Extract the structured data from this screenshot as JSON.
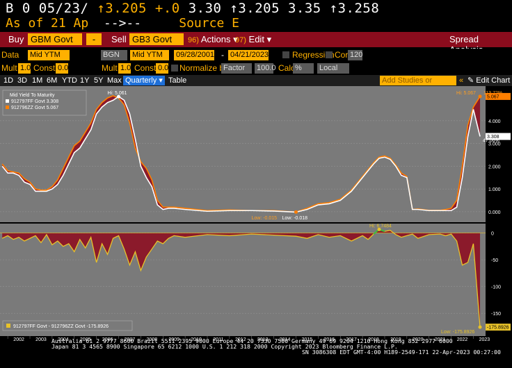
{
  "ticker": {
    "line1_a": "B 0 05/23/ ",
    "line1_b": "↑3.205",
    "line1_c": " +.0 ",
    "line1_d": "3.30 ",
    "line1_e": "↑3.205 3.35 ↑3.258",
    "line2_a": "As of 21 Ap  ",
    "line2_b": "-->--",
    "line2_c": "     Source E"
  },
  "toolbar": {
    "buy_label": "Buy",
    "buy_value": "GBM Govt",
    "minus_label": "-",
    "sell_label": "Sell",
    "sell_value": "GB3 Govt",
    "actions_num": "96)",
    "actions_label": "Actions",
    "edit_num": "97)",
    "edit_label": "Edit",
    "title": "Spread Analysis"
  },
  "params": {
    "data_label": "Data",
    "data_value": "Mid YTM",
    "bgn_value": "BGN",
    "field2_value": "Mid YTM",
    "start_date": "09/28/2001",
    "end_date": "04/21/2023",
    "regression_label": "Regression",
    "corr_label": "Corr",
    "corr_value": "120",
    "mult_label": "Mult",
    "mult_value": "1.0",
    "const_label": "Const",
    "const_value": "0.0",
    "mult2_label": "Mult",
    "mult2_value": "1.0",
    "const2_label": "Const",
    "const2_value": "0.0",
    "normalize_label": "Normalize by",
    "factor_value": "Factor",
    "factor_num": "100.0",
    "calc_label": "Calc",
    "calc_value": "%",
    "ccy_value": "Local CCY"
  },
  "range": {
    "items": [
      "1D",
      "3D",
      "1M",
      "6M",
      "YTD",
      "1Y",
      "5Y",
      "Max"
    ],
    "active": "Quarterly",
    "table": "Table",
    "add_studies": "Add Studies or Events",
    "edit_chart": "Edit Chart"
  },
  "chart_data": [
    {
      "type": "line",
      "title": "Mid Yield To Maturity",
      "x": [
        2001.75,
        2002.0,
        2002.25,
        2002.5,
        2002.75,
        2003.0,
        2003.25,
        2003.5,
        2003.75,
        2004.0,
        2004.25,
        2004.5,
        2004.75,
        2005.0,
        2005.25,
        2005.5,
        2005.75,
        2006.0,
        2006.25,
        2006.5,
        2006.75,
        2007.0,
        2007.25,
        2007.5,
        2007.75,
        2008.0,
        2008.25,
        2008.5,
        2008.75,
        2009.0,
        2009.25,
        2009.5,
        2010.0,
        2011.0,
        2012.0,
        2013.0,
        2014.0,
        2015.0,
        2015.5,
        2016.0,
        2016.5,
        2017.0,
        2017.5,
        2018.0,
        2018.25,
        2018.5,
        2018.75,
        2019.0,
        2019.25,
        2019.5,
        2019.75,
        2020.0,
        2020.25,
        2020.5,
        2021.0,
        2021.5,
        2021.75,
        2022.0,
        2022.25,
        2022.5,
        2022.75,
        2023.0,
        2023.3
      ],
      "series": [
        {
          "name": "912797FF Govt",
          "last": "3.308",
          "color": "#ffffff",
          "values": [
            2.0,
            1.7,
            1.7,
            1.6,
            1.3,
            1.2,
            0.9,
            0.9,
            0.9,
            1.0,
            1.2,
            1.6,
            2.1,
            2.6,
            2.8,
            3.2,
            3.6,
            4.3,
            4.6,
            4.8,
            4.9,
            5.06,
            4.9,
            4.3,
            3.2,
            2.0,
            1.5,
            1.1,
            0.3,
            0.1,
            0.15,
            0.15,
            0.1,
            0.02,
            0.05,
            0.05,
            0.03,
            -0.018,
            0.1,
            0.3,
            0.35,
            0.5,
            0.9,
            1.5,
            1.8,
            2.1,
            2.35,
            2.4,
            2.3,
            2.0,
            1.6,
            1.5,
            0.1,
            0.1,
            0.05,
            0.05,
            0.05,
            0.05,
            0.2,
            1.5,
            3.3,
            4.5,
            3.308
          ]
        },
        {
          "name": "912796ZZ Govt",
          "last": "5.067",
          "color": "#ff7f00",
          "values": [
            2.1,
            1.8,
            1.75,
            1.7,
            1.45,
            1.3,
            1.0,
            0.95,
            0.95,
            1.1,
            1.4,
            1.9,
            2.4,
            2.9,
            3.1,
            3.5,
            3.9,
            4.5,
            4.8,
            5.0,
            5.1,
            5.0,
            4.7,
            3.9,
            2.8,
            2.2,
            1.9,
            1.4,
            0.5,
            0.2,
            0.2,
            0.2,
            0.15,
            0.05,
            0.08,
            0.05,
            0.05,
            -0.015,
            0.15,
            0.35,
            0.4,
            0.55,
            0.95,
            1.55,
            1.85,
            2.15,
            2.4,
            2.45,
            2.35,
            2.05,
            1.7,
            1.55,
            0.1,
            0.12,
            0.06,
            0.06,
            0.1,
            0.15,
            0.5,
            2.0,
            3.8,
            4.6,
            5.067
          ]
        }
      ],
      "hi_white": "Hi: 5.061",
      "hi_orange": "Hi: 5.067",
      "hi_pct": "113.72%",
      "low_orange": "Low: -0.015",
      "low_white": "Low: -0.018",
      "last_pct": "47.06%",
      "yticks": [
        "0.000",
        "1.000",
        "2.000",
        "3.000",
        "4.000"
      ],
      "ylim": [
        -0.4,
        5.4
      ]
    },
    {
      "type": "area",
      "title": "912797FF Govt - 912796ZZ Govt",
      "last": "-175.8926",
      "hi": "Hi: 6.7484",
      "low": "Low: -175.8926",
      "x": [
        2001.75,
        2002.0,
        2002.25,
        2002.5,
        2002.75,
        2003.0,
        2003.25,
        2003.5,
        2003.75,
        2004.0,
        2004.25,
        2004.5,
        2004.75,
        2005.0,
        2005.25,
        2005.5,
        2005.75,
        2006.0,
        2006.25,
        2006.5,
        2006.75,
        2007.0,
        2007.25,
        2007.5,
        2007.75,
        2008.0,
        2008.25,
        2008.5,
        2008.75,
        2009.0,
        2009.25,
        2009.5,
        2010.0,
        2011.0,
        2012.0,
        2013.0,
        2014.0,
        2015.0,
        2015.5,
        2016.0,
        2016.5,
        2017.0,
        2017.5,
        2018.0,
        2018.25,
        2018.5,
        2018.75,
        2019.0,
        2019.25,
        2019.5,
        2019.75,
        2020.0,
        2020.25,
        2020.5,
        2021.0,
        2021.5,
        2021.75,
        2022.0,
        2022.25,
        2022.5,
        2022.75,
        2023.0,
        2023.3
      ],
      "values": [
        -10,
        -5,
        -12,
        -8,
        -15,
        -10,
        -5,
        -18,
        -3,
        -22,
        -15,
        -25,
        -20,
        -35,
        -12,
        -28,
        -8,
        -55,
        -20,
        -40,
        -10,
        -5,
        -30,
        -60,
        -35,
        -70,
        -45,
        -30,
        -15,
        -20,
        -10,
        -5,
        -8,
        -3,
        -5,
        -2,
        -4,
        -6,
        -10,
        -3,
        -8,
        -5,
        -15,
        -5,
        -12,
        -2,
        6.7,
        3,
        5,
        -3,
        -8,
        -5,
        -2,
        -10,
        -3,
        -2,
        -5,
        -2,
        -15,
        -60,
        -55,
        -20,
        -175.8926
      ],
      "yticks": [
        "0",
        "-50",
        "-100",
        "-150"
      ],
      "ylim": [
        -190,
        15
      ],
      "xticks": [
        "2002",
        "2003",
        "2004",
        "2005",
        "2006",
        "2007",
        "2008",
        "2009",
        "2010",
        "2011",
        "2012",
        "2013",
        "2014",
        "2015",
        "2016",
        "2017",
        "2018",
        "2019",
        "2020",
        "2021",
        "2022",
        "2023"
      ]
    }
  ],
  "footer": {
    "line1": "Australia 61 2 9777 8600 Brazil 5511 2395 9000 Europe 44 20 7330 7500 Germany 49 69 9204 1210 Hong Kong 852 2977 6000",
    "line2": "Japan 81 3 4565 8900        Singapore 65 6212 1000        U.S. 1 212 318 2000        Copyright 2023 Bloomberg Finance L.P.",
    "line3": "SN 3086308 EDT  GMT-4:00 H189-2549-171 22-Apr-2023 00:27:00"
  }
}
